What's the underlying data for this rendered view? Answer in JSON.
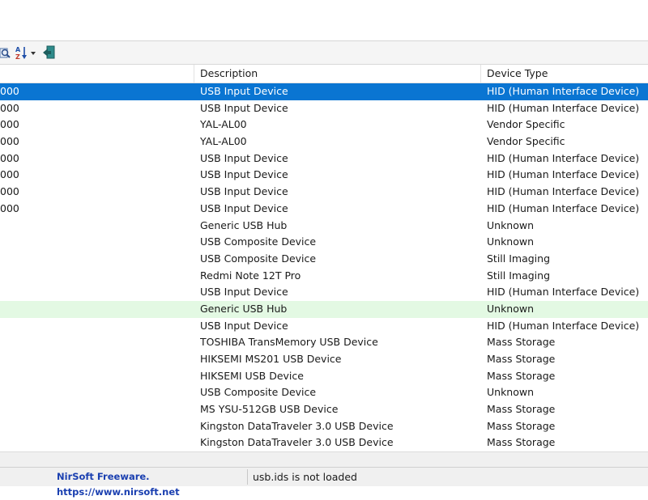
{
  "toolbar": {
    "icons": [
      "find-icon",
      "sort-icon",
      "exit-icon"
    ]
  },
  "columns": [
    "Description",
    "Device Type"
  ],
  "rows": [
    {
      "id_fragment": "000",
      "description": "USB Input Device",
      "device_type": "HID (Human Interface Device)",
      "state": "selected"
    },
    {
      "id_fragment": "000",
      "description": "USB Input Device",
      "device_type": "HID (Human Interface Device)"
    },
    {
      "id_fragment": "000",
      "description": "YAL-AL00",
      "device_type": "Vendor Specific"
    },
    {
      "id_fragment": "000",
      "description": "YAL-AL00",
      "device_type": "Vendor Specific"
    },
    {
      "id_fragment": "000",
      "description": "USB Input Device",
      "device_type": "HID (Human Interface Device)"
    },
    {
      "id_fragment": "000",
      "description": "USB Input Device",
      "device_type": "HID (Human Interface Device)"
    },
    {
      "id_fragment": "000",
      "description": "USB Input Device",
      "device_type": "HID (Human Interface Device)"
    },
    {
      "id_fragment": "000",
      "description": "USB Input Device",
      "device_type": "HID (Human Interface Device)"
    },
    {
      "id_fragment": "",
      "description": "Generic USB Hub",
      "device_type": "Unknown"
    },
    {
      "id_fragment": "",
      "description": "USB Composite Device",
      "device_type": "Unknown"
    },
    {
      "id_fragment": "",
      "description": "USB Composite Device",
      "device_type": "Still Imaging"
    },
    {
      "id_fragment": "",
      "description": "Redmi Note 12T Pro",
      "device_type": "Still Imaging"
    },
    {
      "id_fragment": "",
      "description": "USB Input Device",
      "device_type": "HID (Human Interface Device)"
    },
    {
      "id_fragment": "",
      "description": "Generic USB Hub",
      "device_type": "Unknown",
      "state": "highlight"
    },
    {
      "id_fragment": "",
      "description": "USB Input Device",
      "device_type": "HID (Human Interface Device)"
    },
    {
      "id_fragment": "",
      "description": "TOSHIBA TransMemory USB Device",
      "device_type": "Mass Storage"
    },
    {
      "id_fragment": "",
      "description": "HIKSEMI MS201 USB Device",
      "device_type": "Mass Storage"
    },
    {
      "id_fragment": "",
      "description": "HIKSEMI USB Device",
      "device_type": "Mass Storage"
    },
    {
      "id_fragment": "",
      "description": "USB Composite Device",
      "device_type": "Unknown"
    },
    {
      "id_fragment": "",
      "description": "MS YSU-512GB USB Device",
      "device_type": "Mass Storage"
    },
    {
      "id_fragment": "",
      "description": "Kingston DataTraveler 3.0 USB Device",
      "device_type": "Mass Storage"
    },
    {
      "id_fragment": "",
      "description": "Kingston DataTraveler 3.0 USB Device",
      "device_type": "Mass Storage"
    }
  ],
  "status": {
    "brand": "NirSoft Freeware.  https://www.nirsoft.net",
    "message": "usb.ids is not loaded"
  },
  "colors": {
    "selected_row": "#0a75d2",
    "highlight_row": "#e3f9e3",
    "brand_text": "#1a3fb0"
  }
}
